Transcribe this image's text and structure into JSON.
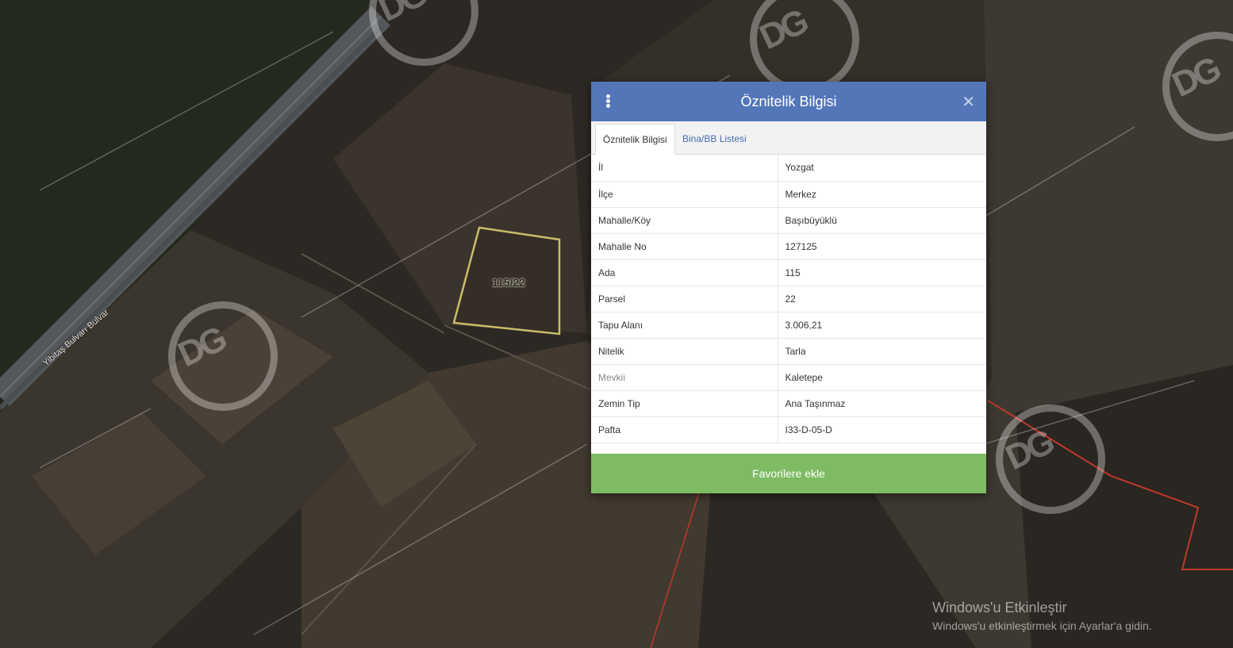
{
  "map": {
    "parcel_label": "115/22",
    "street_label": "Yibitaş Bulvarı Bulvar",
    "watermark_text": "DG"
  },
  "panel": {
    "title": "Öznitelik Bilgisi",
    "menu_icon": "vertical-ellipsis-icon",
    "close_icon": "close-icon",
    "tabs": [
      {
        "label": "Öznitelik Bilgisi",
        "active": true
      },
      {
        "label": "Bina/BB Listesi",
        "active": false
      }
    ],
    "rows": [
      {
        "key": "İl",
        "value": "Yozgat"
      },
      {
        "key": "İlçe",
        "value": "Merkez"
      },
      {
        "key": "Mahalle/Köy",
        "value": "Başıbüyüklü"
      },
      {
        "key": "Mahalle No",
        "value": "127125"
      },
      {
        "key": "Ada",
        "value": "115"
      },
      {
        "key": "Parsel",
        "value": "22"
      },
      {
        "key": "Tapu Alanı",
        "value": "3.006,21"
      },
      {
        "key": "Nitelik",
        "value": "Tarla"
      },
      {
        "key": "Mevkii",
        "value": "Kaletepe"
      },
      {
        "key": "Zemin Tip",
        "value": "Ana Taşınmaz"
      },
      {
        "key": "Pafta",
        "value": "I33-D-05-D"
      }
    ],
    "favorite_button": "Favorilere ekle"
  },
  "windows_activation": {
    "title": "Windows'u Etkinleştir",
    "subtitle": "Windows'u etkinleştirmek için Ayarlar'a gidin."
  },
  "colors": {
    "header": "#5376b9",
    "favorite_button": "#7ebb62",
    "parcel_outline": "#c9bd68",
    "boundary_line": "#c0392b"
  }
}
